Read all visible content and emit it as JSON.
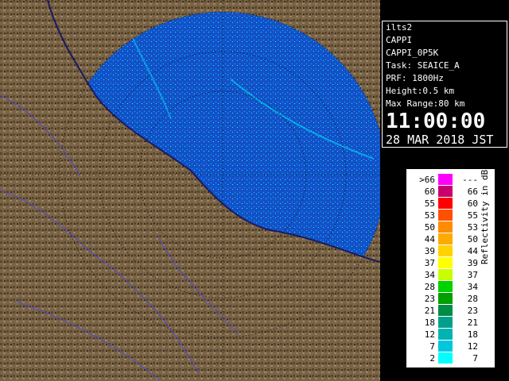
{
  "info": {
    "station": "ilts2",
    "product": "CAPPI",
    "product_id": "CAPPI_0P5K",
    "task": "Task: SEAICE_A",
    "prf": "PRF: 1800Hz",
    "height": "Height:0.5 km",
    "max_range": "Max Range:80 km",
    "time": "11:00:00",
    "date": "28 MAR 2018 JST"
  },
  "legend": {
    "axis_label": "Reflectivity in dBZ",
    "rows": [
      {
        "lo": ">66",
        "hi": "---",
        "color": "#ff00ff"
      },
      {
        "lo": "60",
        "hi": "66",
        "color": "#c8006e"
      },
      {
        "lo": "55",
        "hi": "60",
        "color": "#ff0000"
      },
      {
        "lo": "53",
        "hi": "55",
        "color": "#ff5000"
      },
      {
        "lo": "50",
        "hi": "53",
        "color": "#ff8c00"
      },
      {
        "lo": "44",
        "hi": "50",
        "color": "#ffaa00"
      },
      {
        "lo": "39",
        "hi": "44",
        "color": "#ffd200"
      },
      {
        "lo": "37",
        "hi": "39",
        "color": "#ffff00"
      },
      {
        "lo": "34",
        "hi": "37",
        "color": "#c8ff00"
      },
      {
        "lo": "28",
        "hi": "34",
        "color": "#00d200"
      },
      {
        "lo": "23",
        "hi": "28",
        "color": "#00a000"
      },
      {
        "lo": "21",
        "hi": "23",
        "color": "#008c46"
      },
      {
        "lo": "18",
        "hi": "21",
        "color": "#00a08c"
      },
      {
        "lo": "12",
        "hi": "18",
        "color": "#00b4b4"
      },
      {
        "lo": "7",
        "hi": "12",
        "color": "#00c8dc"
      },
      {
        "lo": "2",
        "hi": "7",
        "color": "#00ffff"
      }
    ]
  }
}
